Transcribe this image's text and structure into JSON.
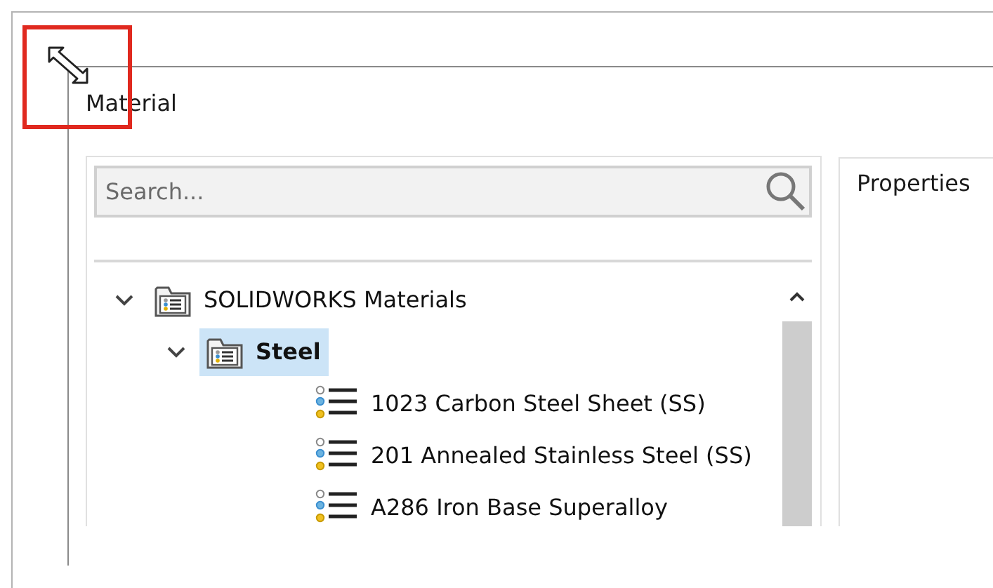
{
  "window": {
    "title": "Material"
  },
  "search": {
    "placeholder": "Search..."
  },
  "tree": [
    {
      "kind": "folder",
      "label": "SOLIDWORKS Materials",
      "expanded": true,
      "selected": false,
      "children": [
        {
          "kind": "folder",
          "label": "Steel",
          "expanded": true,
          "selected": true,
          "children": [
            {
              "kind": "material",
              "label": "1023 Carbon Steel Sheet (SS)",
              "selected": false
            },
            {
              "kind": "material",
              "label": "201 Annealed Stainless Steel (SS)",
              "selected": false
            },
            {
              "kind": "material",
              "label": "A286 Iron Base Superalloy",
              "selected": false
            }
          ]
        }
      ]
    }
  ],
  "properties": {
    "heading": "Properties"
  }
}
